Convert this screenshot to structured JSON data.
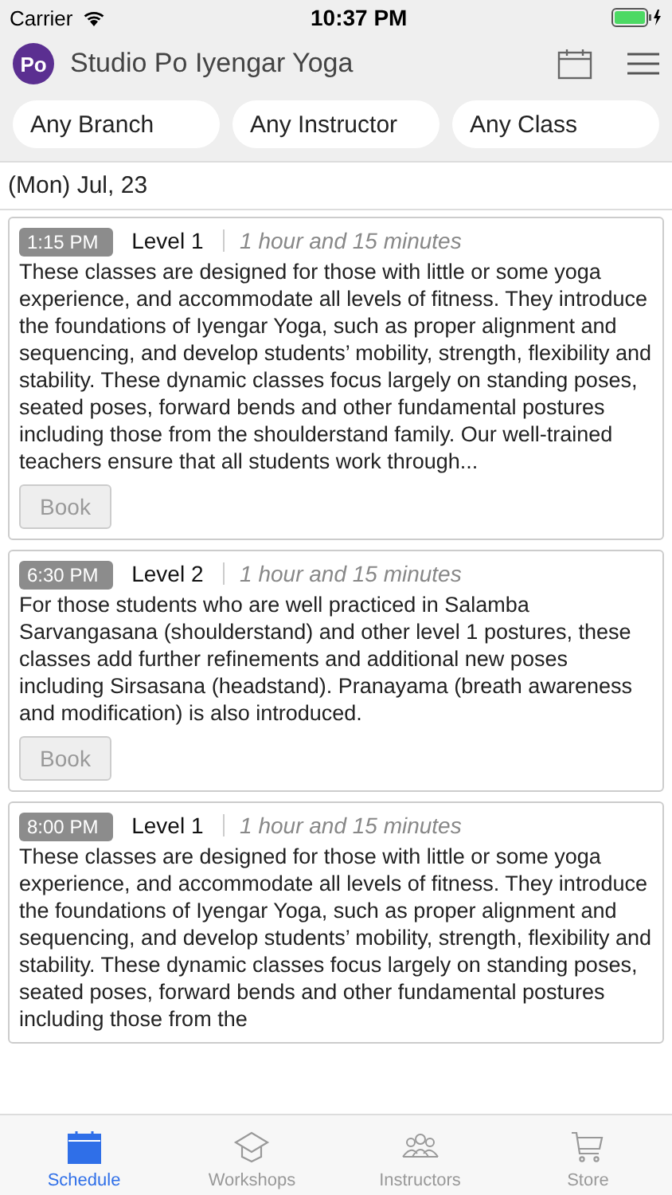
{
  "status_bar": {
    "carrier": "Carrier",
    "time": "10:37 PM"
  },
  "header": {
    "logo_text": "Po",
    "title": "Studio Po Iyengar Yoga"
  },
  "filters": [
    {
      "label": "Any Branch"
    },
    {
      "label": "Any Instructor"
    },
    {
      "label": "Any Class"
    }
  ],
  "date": "(Mon) Jul, 23",
  "classes": [
    {
      "time": "1:15 PM",
      "name": "Level 1",
      "duration": "1 hour and 15 minutes",
      "description": "These classes are designed for those with little or some yoga experience, and accommodate all levels of fitness. They introduce the foundations of Iyengar Yoga, such as proper alignment and sequencing, and develop students’ mobility, strength, flexibility and stability. These dynamic classes focus largely on standing poses, seated poses, forward bends and other fundamental postures including those from the shoulderstand family. Our well-trained teachers ensure that all students work through...",
      "button": {
        "label": "Book",
        "disabled": true
      }
    },
    {
      "time": "6:30 PM",
      "name": "Level 2",
      "duration": "1 hour and 15 minutes",
      "description": "For those students who are well practiced in Salamba Sarvangasana (shoulderstand) and other level 1 postures, these classes add further refinements and additional new poses including Sirsasana (headstand). Pranayama (breath awareness and modification) is also introduced.",
      "button": {
        "label": "Book",
        "disabled": true
      }
    },
    {
      "time": "8:00 PM",
      "name": "Level 1",
      "duration": "1 hour and 15 minutes",
      "description": "These classes are designed for those with little or some yoga experience, and accommodate all levels of fitness. They introduce the foundations of Iyengar Yoga, such as proper alignment and sequencing, and develop students’ mobility, strength, flexibility and stability. These dynamic classes focus largely on standing poses, seated poses, forward bends and other fundamental postures including those from the"
    }
  ],
  "tab_bar": [
    {
      "label": "Schedule",
      "kind": "calendar",
      "selected": true
    },
    {
      "label": "Workshops",
      "kind": "cap",
      "selected": false
    },
    {
      "label": "Instructors",
      "kind": "people",
      "selected": false
    },
    {
      "label": "Store",
      "kind": "cart",
      "selected": false
    }
  ]
}
